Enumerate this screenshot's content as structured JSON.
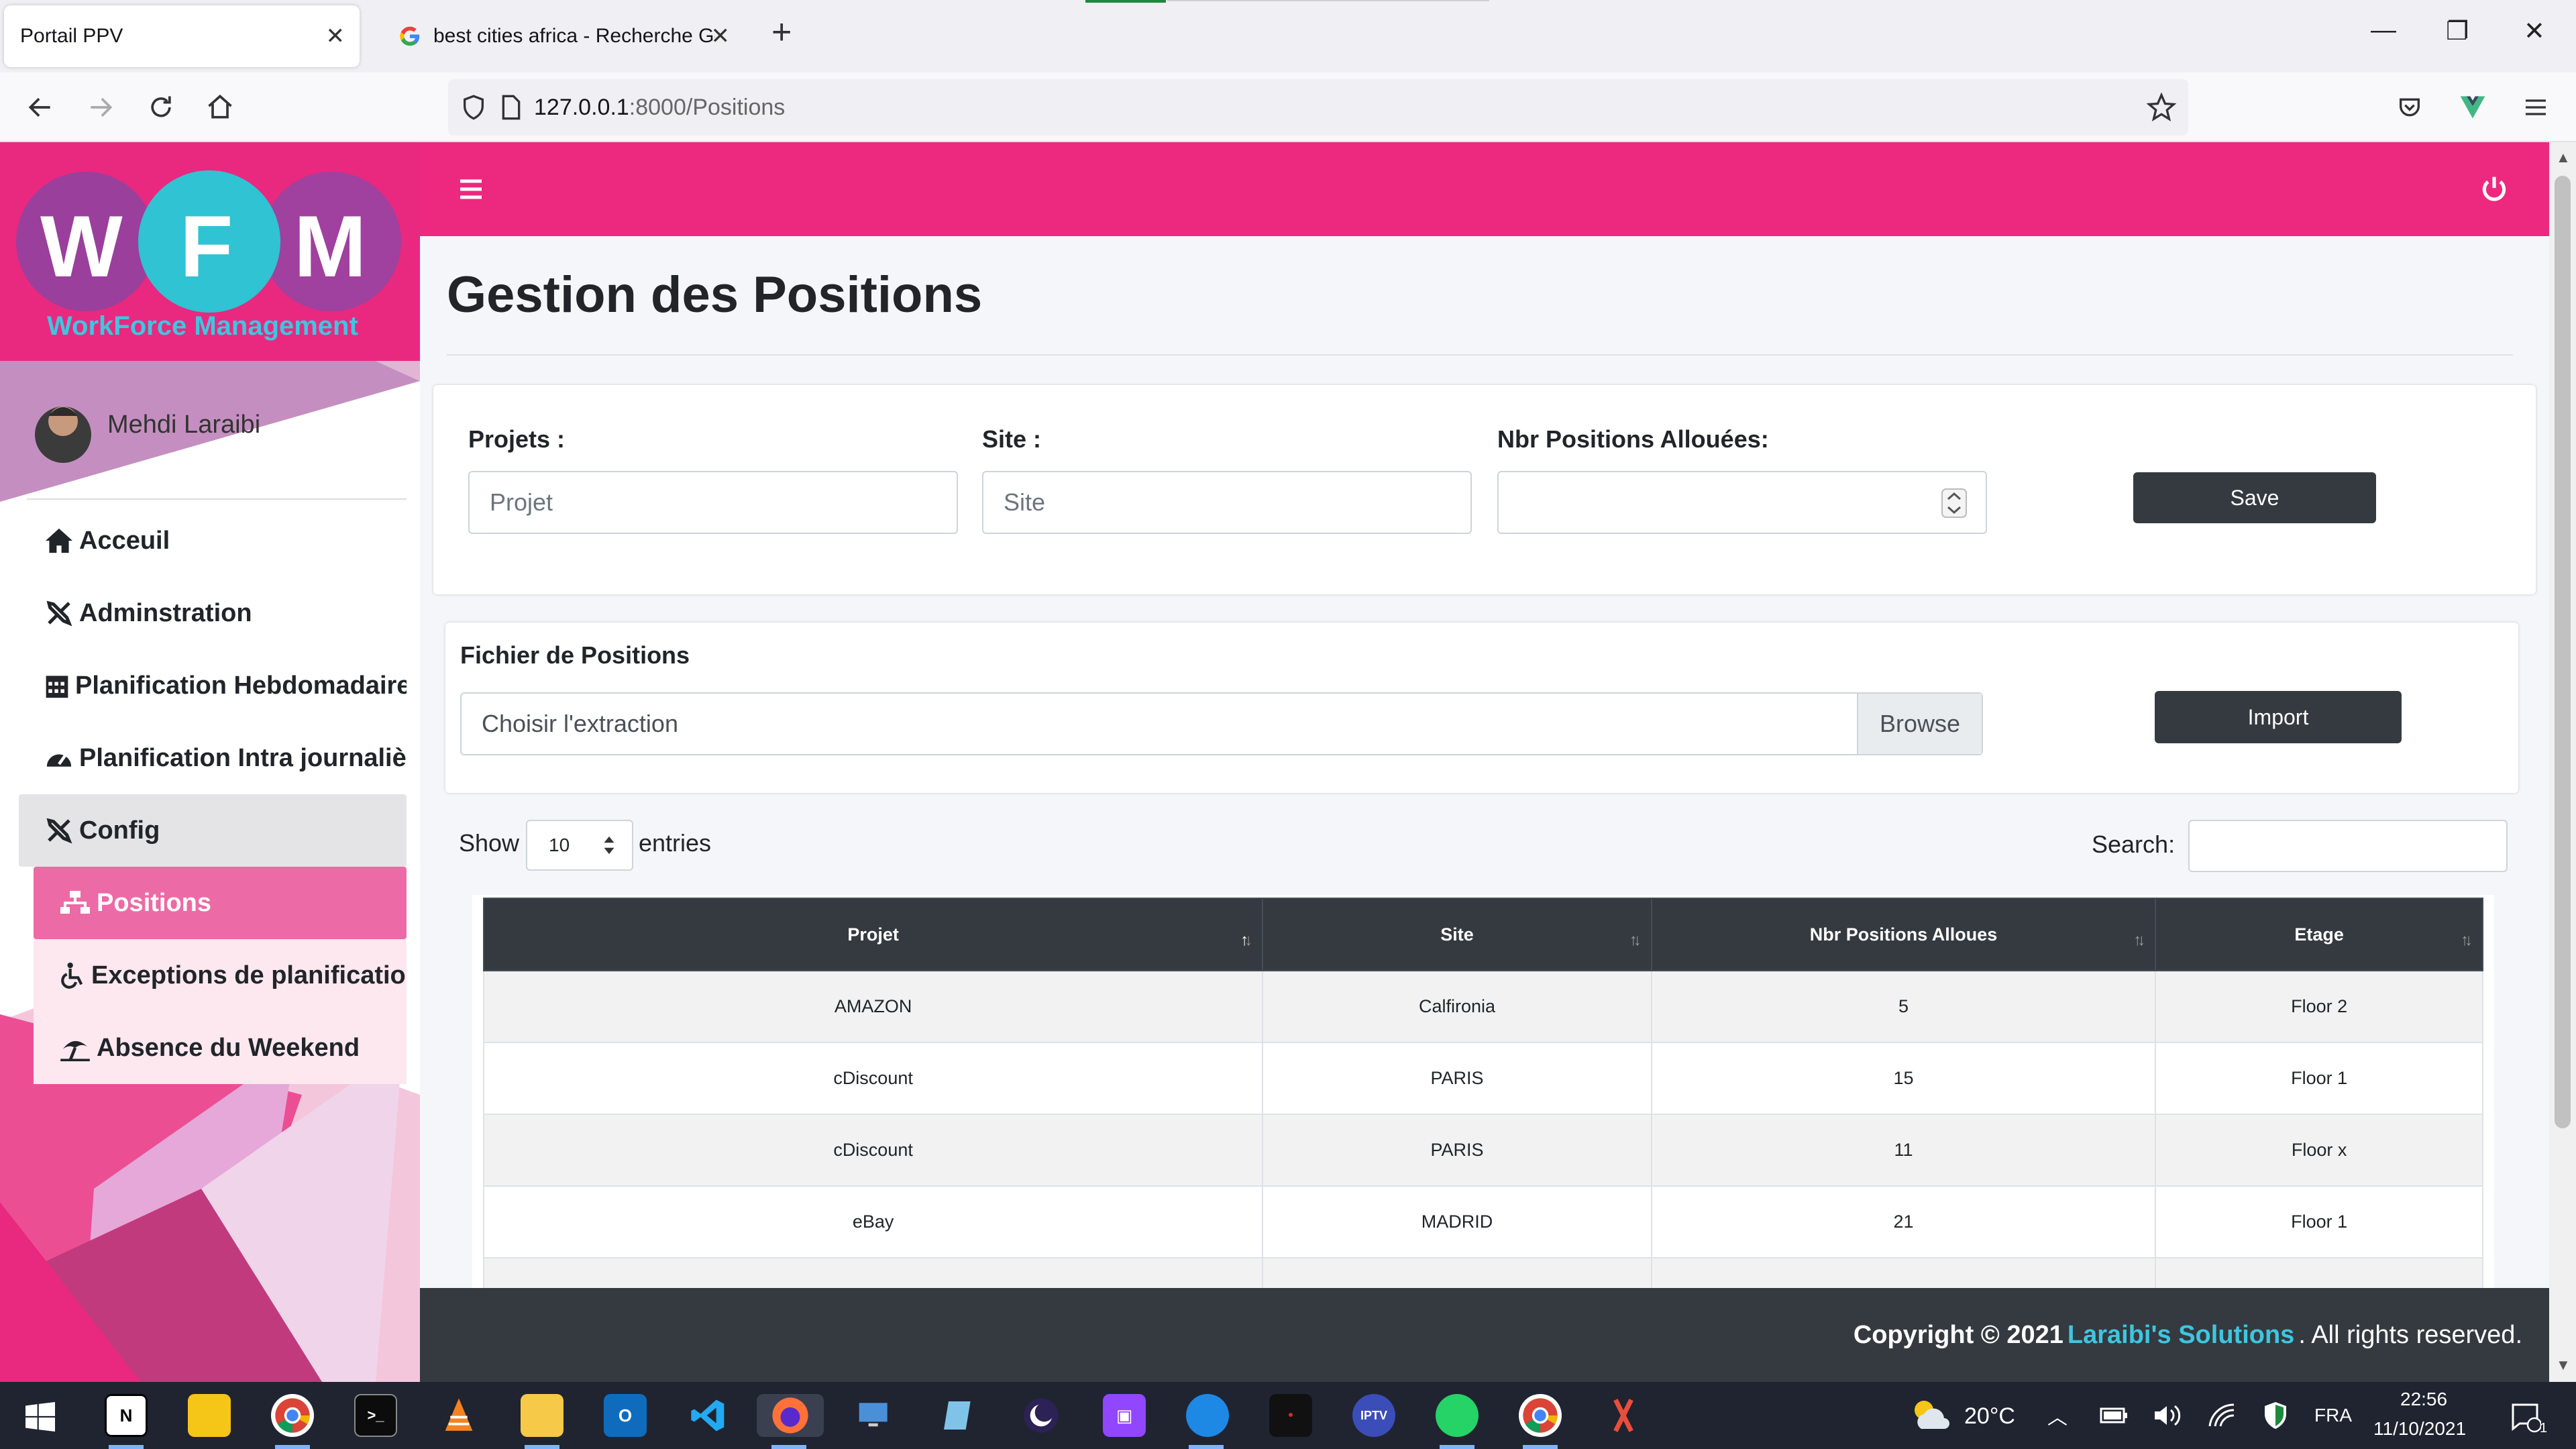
{
  "browser": {
    "tabs": [
      {
        "title": "Portail PPV",
        "active": true
      },
      {
        "title": "best cities africa - Recherche Go",
        "active": false
      }
    ],
    "url_host": "127.0.0.1",
    "url_rest": ":8000/Positions"
  },
  "sidebar": {
    "logo_letters": [
      "W",
      "F",
      "M"
    ],
    "logo_subtitle": "WorkForce Management",
    "user_name": "Mehdi Laraibi",
    "menu": [
      {
        "label": "Acceuil",
        "icon": "home-icon"
      },
      {
        "label": "Adminstration",
        "icon": "tools-icon"
      },
      {
        "label": "Planification Hebdomadaire",
        "icon": "calendar-icon"
      },
      {
        "label": "Planification Intra journalière",
        "icon": "gauge-icon"
      },
      {
        "label": "Config",
        "icon": "tools-icon"
      }
    ],
    "submenu": [
      {
        "label": "Positions",
        "icon": "sitemap-icon"
      },
      {
        "label": "Exceptions de planification",
        "icon": "wheelchair-icon"
      },
      {
        "label": "Absence du Weekend",
        "icon": "beach-umbrella-icon"
      }
    ]
  },
  "page": {
    "title": "Gestion des Positions"
  },
  "form": {
    "projets_label": "Projets :",
    "projets_placeholder": "Projet",
    "site_label": "Site :",
    "site_placeholder": "Site",
    "nbr_label": "Nbr Positions Allouées:",
    "save_label": "Save"
  },
  "import": {
    "title": "Fichier de Positions",
    "file_placeholder": "Choisir l'extraction",
    "browse_label": "Browse",
    "import_label": "Import"
  },
  "table_controls": {
    "show_label": "Show",
    "entries_value": "10",
    "entries_label": "entries",
    "search_label": "Search:"
  },
  "table": {
    "columns": [
      "Projet",
      "Site",
      "Nbr Positions Alloues",
      "Etage"
    ],
    "rows": [
      [
        "AMAZON",
        "Calfironia",
        "5",
        "Floor 2"
      ],
      [
        "cDiscount",
        "PARIS",
        "15",
        "Floor 1"
      ],
      [
        "cDiscount",
        "PARIS",
        "11",
        "Floor x"
      ],
      [
        "eBay",
        "MADRID",
        "21",
        "Floor 1"
      ]
    ]
  },
  "footer": {
    "prefix": "Copyright © 2021",
    "company": "Laraibi's Solutions",
    "suffix": ". All rights reserved."
  },
  "taskbar": {
    "weather": "20°C",
    "language": "FRA",
    "time": "22:56",
    "date": "11/10/2021",
    "notification_count": "1"
  },
  "colors": {
    "brand_pink": "#ec297f",
    "dark": "#343a40",
    "link_cyan": "#3ec6e0"
  }
}
